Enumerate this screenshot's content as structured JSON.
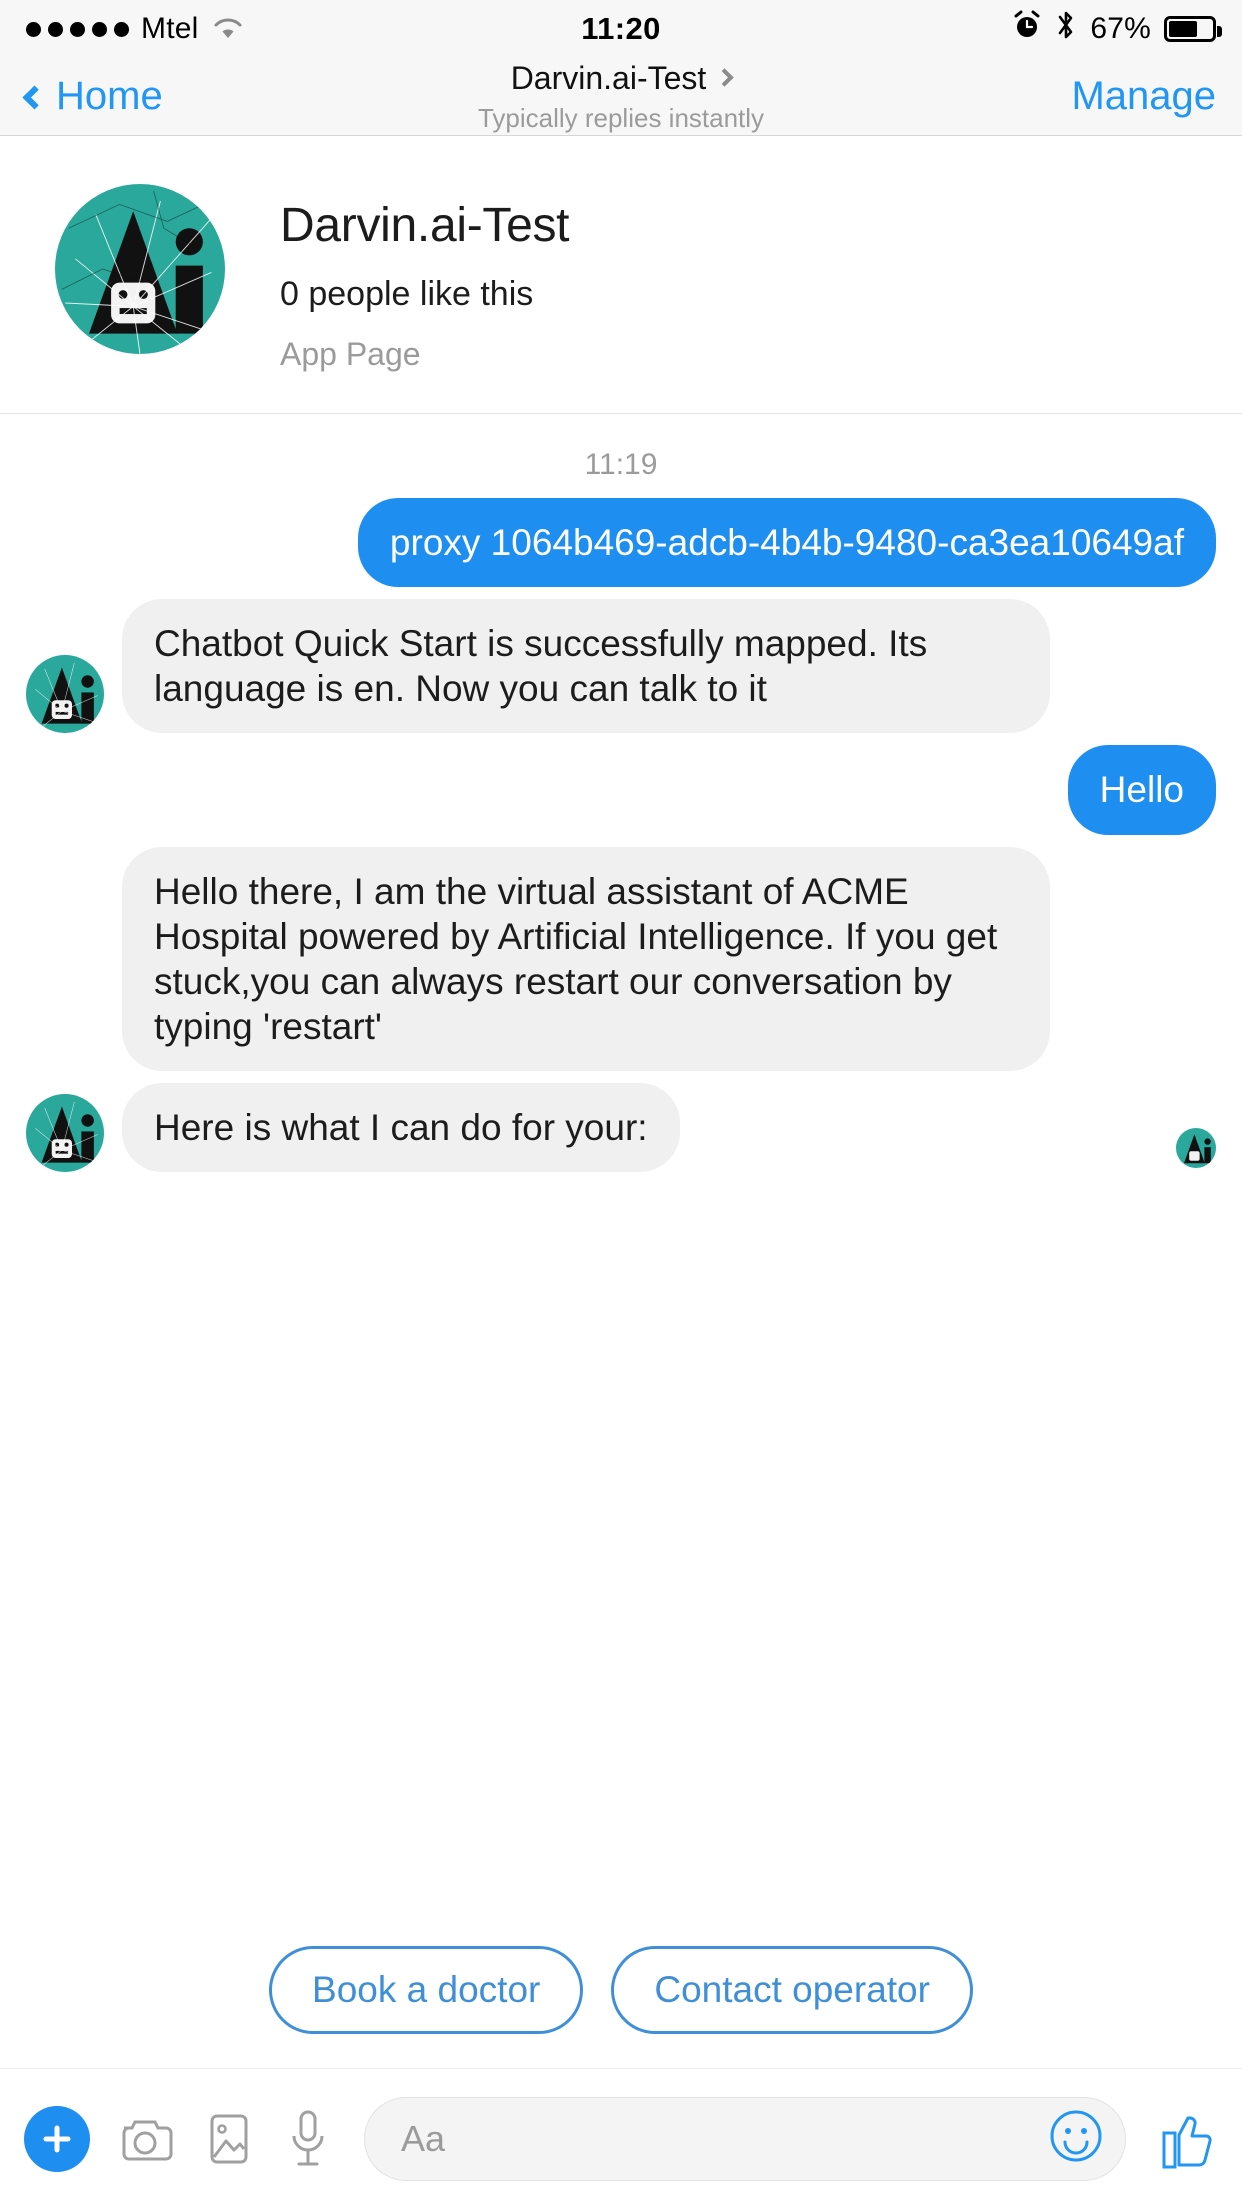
{
  "status_bar": {
    "signal_dots": 5,
    "carrier": "Mtel",
    "wifi_icon": "wifi-icon",
    "time": "11:20",
    "alarm_icon": "alarm-icon",
    "bluetooth_icon": "bluetooth-icon",
    "battery_percent": "67%",
    "battery_level": 67
  },
  "nav_bar": {
    "back_label": "Home",
    "back_icon": "chevron-left-icon",
    "title": "Darvin.ai-Test",
    "title_chevron_icon": "chevron-right-icon",
    "subtitle": "Typically replies instantly",
    "manage_label": "Manage"
  },
  "profile": {
    "avatar_icon": "darvin-ai-logo-avatar",
    "name": "Darvin.ai-Test",
    "likes": "0 people like this",
    "page_type": "App Page"
  },
  "thread": {
    "timestamp": "11:19",
    "messages": [
      {
        "side": "out",
        "text": "proxy 1064b469-adcb-4b4b-9480-ca3ea10649af"
      },
      {
        "side": "in",
        "text": "Chatbot Quick Start is successfully mapped. Its language is en. Now you can talk to it"
      },
      {
        "side": "out",
        "text": "Hello"
      },
      {
        "side": "in",
        "text": "Hello there, I am the virtual assistant of ACME Hospital powered by Artificial Intelligence. If you get stuck,you can always restart our conversation by typing 'restart'"
      },
      {
        "side": "in",
        "text": "Here is what I can do for your:"
      }
    ],
    "seen_avatar_icon": "seen-avatar-icon"
  },
  "quick_replies": [
    {
      "label": "Book a doctor"
    },
    {
      "label": "Contact operator"
    }
  ],
  "composer": {
    "plus_icon": "plus-icon",
    "camera_icon": "camera-icon",
    "gallery_icon": "gallery-icon",
    "microphone_icon": "microphone-icon",
    "input_placeholder": "Aa",
    "emoji_icon": "smiley-icon",
    "like_icon": "thumbs-up-icon"
  },
  "colors": {
    "accent_blue": "#1f8ef1",
    "link_blue": "#2196f3",
    "quick_reply_blue": "#3f8fd8",
    "bubble_gray": "#f0f0f0",
    "avatar_teal": "#2aa89c",
    "muted_text": "#9b9b9b"
  }
}
